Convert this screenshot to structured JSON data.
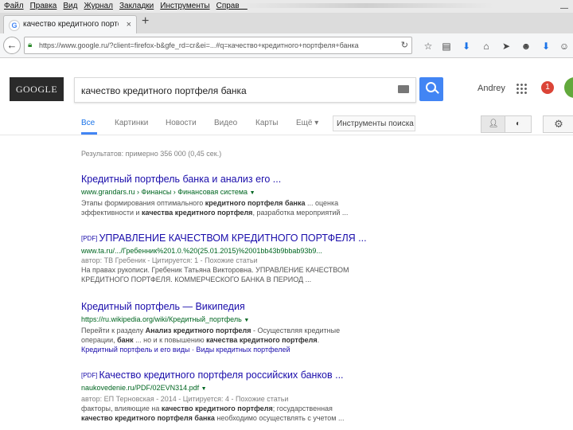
{
  "menubar": {
    "items": [
      "Файл",
      "Правка",
      "Вид",
      "Журнал",
      "Закладки",
      "Инструменты",
      "Справка"
    ]
  },
  "tab": {
    "favicon": "G",
    "title": "качество кредитного портф...",
    "close": "×",
    "new_tab": "+"
  },
  "navbar": {
    "url": "https://www.google.ru/?client=firefox-b&gfe_rd=cr&ei=...#q=качество+кредитного+портфеля+банка",
    "reload": "↻"
  },
  "google": {
    "logo": "GOOGLE",
    "query": "качество кредитного портфеля банка",
    "user": "Andrey",
    "notifications": "1"
  },
  "search_tabs": [
    "Все",
    "Картинки",
    "Новости",
    "Видео",
    "Карты",
    "Ещё ▾"
  ],
  "tools_label": "Инструменты поиска",
  "stats": "Результатов: примерно 356 000 (0,45 сек.)",
  "results": [
    {
      "title": "Кредитный портфель банка и анализ его ...",
      "pdf": "",
      "url": "www.grandars.ru › Финансы › Финансовая система",
      "meta": "",
      "snippet_lines": [
        "Этапы формирования оптимального кредитного портфеля банка ... оценка",
        "эффективности и качества кредитного портфеля, разработка мероприятий ..."
      ]
    },
    {
      "title": "УПРАВЛЕНИЕ КАЧЕСТВОМ КРЕДИТНОГО ПОРТФЕЛЯ ...",
      "pdf": "[PDF]",
      "url": "www.ta.ru/.../Гребенник%201.0.%20(25.01.2015)%2001bb43b9bbab93b9...",
      "meta": "автор: ТВ Гребеник - Цитируется: 1 - Похожие статьи",
      "snippet_lines": [
        "На правах рукописи. Гребеник Татьяна Викторовна. УПРАВЛЕНИЕ КАЧЕСТВОМ",
        "КРЕДИТНОГО ПОРТФЕЛЯ. КОММЕРЧЕСКОГО БАНКА В ПЕРИОД ..."
      ]
    },
    {
      "title": "Кредитный портфель — Википедия",
      "pdf": "",
      "url": "https://ru.wikipedia.org/wiki/Кредитный_портфель",
      "meta": "",
      "snippet_lines": [
        "Перейти к разделу Анализ кредитного портфеля - Осуществляя кредитные",
        "операции, банк ... но и к повышению качества кредитного портфеля.",
        "Кредитный портфель и его виды · Виды кредитных портфелей"
      ]
    },
    {
      "title": "Качество кредитного портфеля российских банков ...",
      "pdf": "[PDF]",
      "url": "naukovedenie.ru/PDF/02EVN314.pdf",
      "meta": "автор: ЕП Терновская - 2014 - Цитируется: 4 - Похожие статьи",
      "snippet_lines": [
        "факторы, влияющие на качество кредитного портфеля; государственная",
        "качество кредитного портфеля банка необходимо осуществлять с учетом ..."
      ]
    }
  ],
  "colors": {
    "link": "#1a0dab",
    "url_green": "#006621",
    "search_blue": "#4285f4",
    "notification_red": "#db4437"
  }
}
